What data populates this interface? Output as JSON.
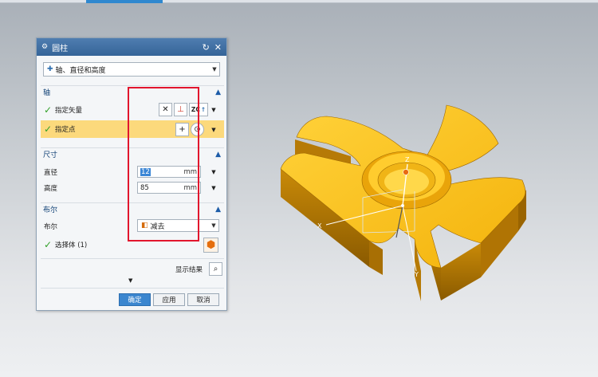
{
  "dialog": {
    "title": "圆柱",
    "type_selector": "轴、直径和高度",
    "sections": {
      "axis": "轴",
      "dimensions": "尺寸",
      "boolean": "布尔"
    },
    "axis": {
      "specify_vector": "指定矢量",
      "specify_point": "指定点",
      "vector_text_icon": "ZC"
    },
    "dimensions": {
      "diameter_label": "直径",
      "diameter_value": "12",
      "height_label": "高度",
      "height_value": "85",
      "unit": "mm"
    },
    "boolean": {
      "label": "布尔",
      "value": "减去",
      "select_body": "选择体 (1)"
    },
    "show_result": "显示结果",
    "buttons": {
      "ok": "确定",
      "apply": "应用",
      "cancel": "取消"
    }
  },
  "viewport": {
    "axis_labels": {
      "x": "X",
      "y": "Y",
      "z": "Z"
    }
  },
  "colors": {
    "title_bar": "#3f6fa3",
    "highlight_row": "#fcd97c",
    "primary_button": "#3b86cf",
    "annotation_box": "#e2152d",
    "model_face": "#f7bb14"
  }
}
